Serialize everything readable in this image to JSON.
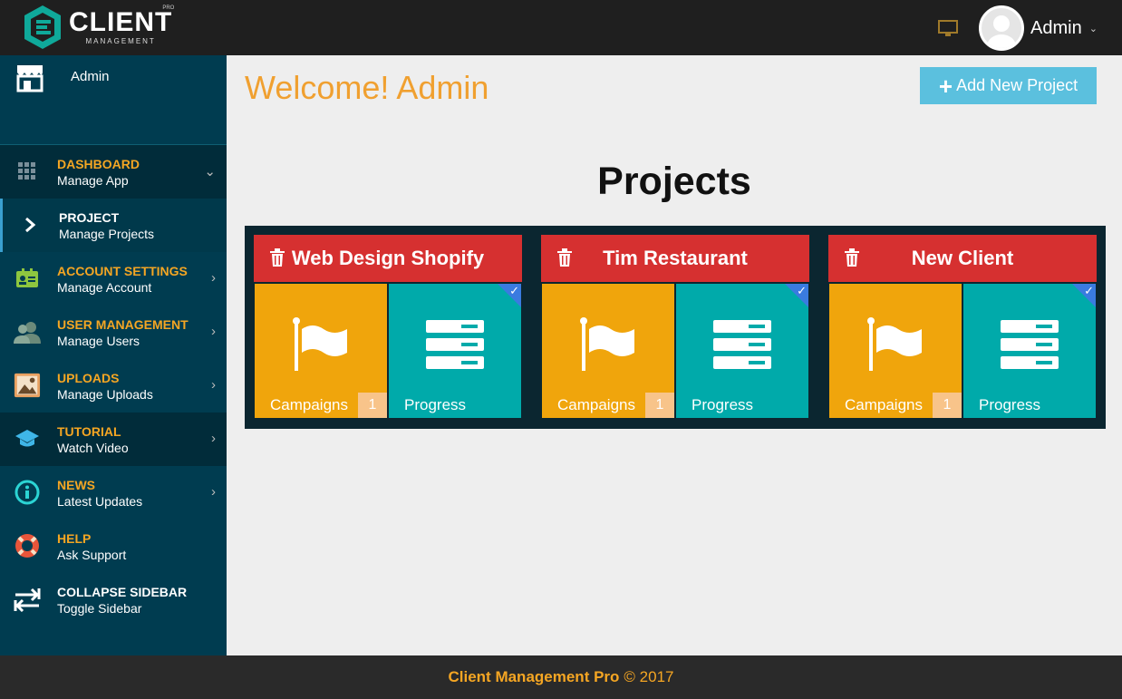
{
  "header": {
    "logo_title": "CLIENT",
    "logo_sub": "MANAGEMENT",
    "logo_pro": "PRO",
    "user_name": "Admin"
  },
  "sidebar": {
    "user_name": "Admin",
    "items": [
      {
        "title": "DASHBOARD",
        "sub": "Manage App",
        "icon": "grid-icon"
      },
      {
        "title": "PROJECT",
        "sub": "Manage Projects",
        "icon": "chevron-right-icon"
      },
      {
        "title": "ACCOUNT SETTINGS",
        "sub": "Manage Account",
        "icon": "id-card-icon"
      },
      {
        "title": "USER MANAGEMENT",
        "sub": "Manage Users",
        "icon": "users-icon"
      },
      {
        "title": "UPLOADS",
        "sub": "Manage Uploads",
        "icon": "image-icon"
      },
      {
        "title": "TUTORIAL",
        "sub": "Watch Video",
        "icon": "graduation-cap-icon"
      },
      {
        "title": "NEWS",
        "sub": "Latest Updates",
        "icon": "info-icon"
      },
      {
        "title": "HELP",
        "sub": "Ask Support",
        "icon": "lifebuoy-icon"
      },
      {
        "title": "COLLAPSE SIDEBAR",
        "sub": "Toggle Sidebar",
        "icon": "swap-arrows-icon"
      }
    ]
  },
  "main": {
    "welcome": "Welcome! Admin",
    "add_button": "Add New Project",
    "heading": "Projects",
    "projects": [
      {
        "name": "Web Design Shopify",
        "campaigns_label": "Campaigns",
        "campaigns_count": "1",
        "progress_label": "Progress"
      },
      {
        "name": "Tim Restaurant",
        "campaigns_label": "Campaigns",
        "campaigns_count": "1",
        "progress_label": "Progress"
      },
      {
        "name": "New Client",
        "campaigns_label": "Campaigns",
        "campaigns_count": "1",
        "progress_label": "Progress"
      }
    ]
  },
  "footer": {
    "brand": "Client Management Pro",
    "copy": "© 2017"
  },
  "colors": {
    "accent_orange": "#f5a623",
    "sidebar_bg": "#003c50",
    "card_red": "#d63030",
    "tile_orange": "#f0a50c",
    "tile_teal": "#00aaaa",
    "button_blue": "#5bc0de"
  }
}
